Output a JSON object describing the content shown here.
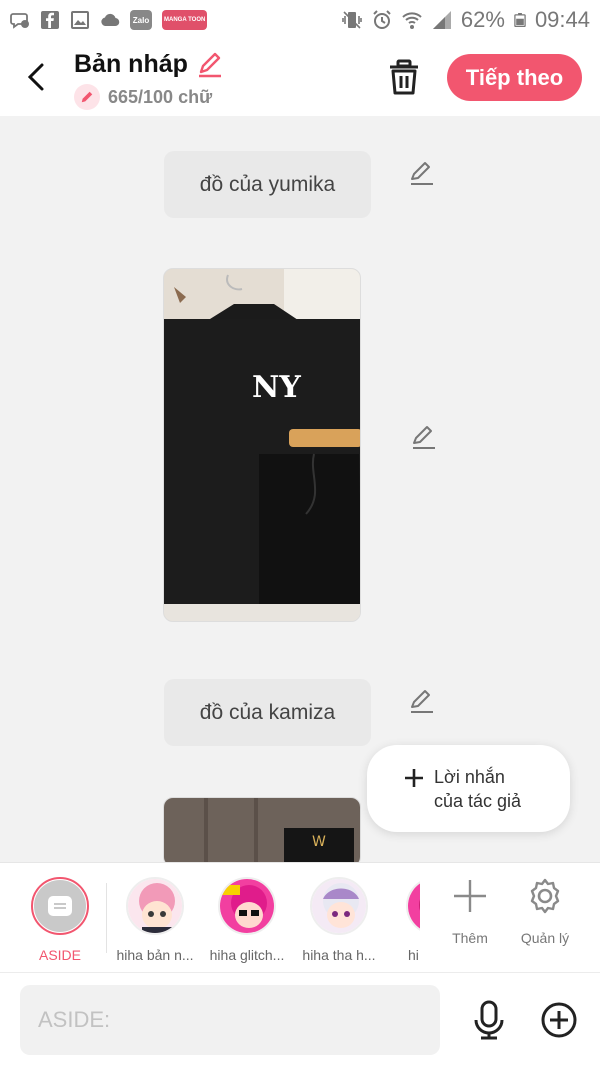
{
  "status_bar": {
    "left_icons": [
      "messenger-icon",
      "facebook-icon",
      "gallery-icon",
      "cloud-icon",
      "zalo-icon",
      "mangatoon-icon"
    ],
    "zalo_label": "Zalo",
    "mangatoon_label": "MANGA TOON",
    "battery": "62%",
    "time": "09:44"
  },
  "header": {
    "title": "Bản nháp",
    "word_count": "665/100 chữ",
    "next_button": "Tiếp theo"
  },
  "content": {
    "messages": [
      {
        "text": "đồ của yumika"
      },
      {
        "text": "đồ của kamiza"
      }
    ],
    "author_note": {
      "line1": "Lời nhắn",
      "line2": "của tác giả"
    }
  },
  "characters": [
    {
      "label": "ASIDE",
      "selected": true
    },
    {
      "label": "hiha bản n..."
    },
    {
      "label": "hiha glitch..."
    },
    {
      "label": "hiha tha h..."
    },
    {
      "label": "hi"
    }
  ],
  "tools": {
    "add_label": "Thêm",
    "manage_label": "Quản lý"
  },
  "input": {
    "placeholder": "ASIDE:"
  },
  "colors": {
    "accent": "#f2566f",
    "background": "#f2f2f2"
  }
}
